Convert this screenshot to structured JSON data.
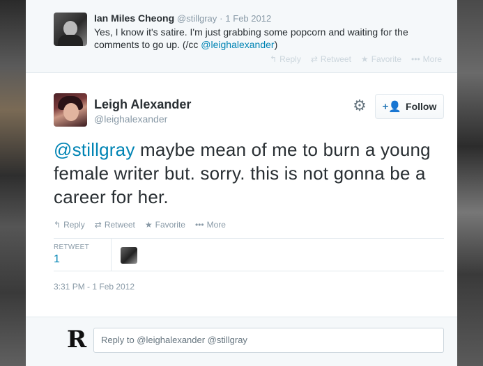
{
  "parent_tweet": {
    "name": "Ian Miles Cheong",
    "handle": "@stillgray",
    "separator": "·",
    "date": "1 Feb 2012",
    "text_before": "Yes, I know it's satire. I'm just grabbing some popcorn and waiting for the comments to go up. (/cc ",
    "mention": "@leighalexander",
    "text_after": ")",
    "actions": {
      "reply": "Reply",
      "retweet": "Retweet",
      "favorite": "Favorite",
      "more": "More"
    }
  },
  "main_tweet": {
    "name": "Leigh Alexander",
    "handle": "@leighalexander",
    "follow_label": "Follow",
    "mention": "@stillgray",
    "text": " maybe mean of me to burn a young female writer but. sorry. this is not gonna be a career for her.",
    "actions": {
      "reply": "Reply",
      "retweet": "Retweet",
      "favorite": "Favorite",
      "more": "More"
    },
    "stats": {
      "label": "RETWEET",
      "value": "1"
    },
    "timestamp": "3:31 PM - 1 Feb 2012"
  },
  "reply_box": {
    "value": "Reply to @leighalexander @stillgray"
  },
  "icons": {
    "reply": "reply-arrow-icon",
    "retweet": "retweet-icon",
    "favorite": "star-icon",
    "more": "more-dots-icon",
    "gear": "gear-icon",
    "follow": "add-user-icon"
  }
}
